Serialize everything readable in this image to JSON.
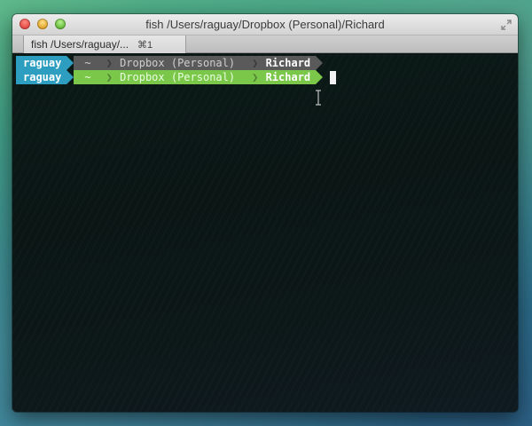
{
  "window": {
    "title": "fish  /Users/raguay/Dropbox (Personal)/Richard",
    "colors": {
      "user_segment": "#2e9ec0",
      "path_gray": "#5a5a5a",
      "path_green": "#7ac74a"
    }
  },
  "tab": {
    "label": "fish  /Users/raguay/...",
    "shortcut": "⌘1"
  },
  "prompt_lines": [
    {
      "user": "raguay",
      "home": "~",
      "dir": "Dropbox (Personal)",
      "current": "Richard"
    },
    {
      "user": "raguay",
      "home": "~",
      "dir": "Dropbox (Personal)",
      "current": "Richard"
    }
  ],
  "icons": [
    "close-icon",
    "minimize-icon",
    "zoom-icon",
    "fullscreen-icon",
    "text-cursor-icon"
  ]
}
